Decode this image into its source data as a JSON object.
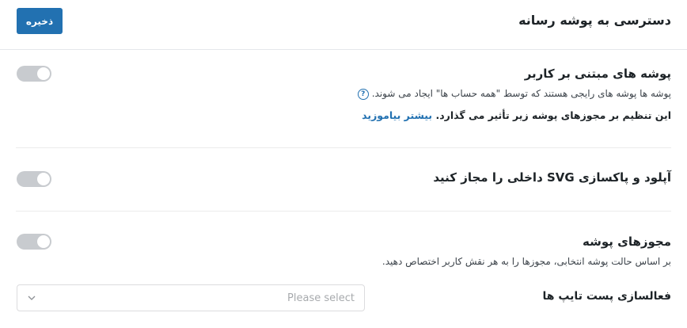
{
  "header": {
    "title": "دسترسی به پوشه رسانه",
    "save_label": "ذخیره"
  },
  "sections": [
    {
      "title": "پوشه های مبتنی بر کاربر",
      "description": "پوشه ها پوشه های رایجی هستند که توسط \"همه حساب ها\" ایجاد می شوند.",
      "note": "این تنظیم بر مجوزهای پوشه زیر تأثیر می گذارد.",
      "link_label": "بیشتر بیاموزید",
      "toggle_on": false,
      "help_icon": "question-circle-icon"
    },
    {
      "title": "آپلود و پاکسازی SVG داخلی را مجاز کنید",
      "toggle_on": false
    },
    {
      "title": "مجوزهای پوشه",
      "description": "بر اساس حالت پوشه انتخابی، مجوزها را به هر نقش کاربر اختصاص دهید.",
      "toggle_on": false
    }
  ],
  "post_types": {
    "label": "فعالسازی پست تایپ ها",
    "placeholder": "Please select",
    "dropdown_icon": "chevron-down-icon"
  },
  "colors": {
    "accent": "#2271b1",
    "toggle_off": "#c8cbcf"
  }
}
